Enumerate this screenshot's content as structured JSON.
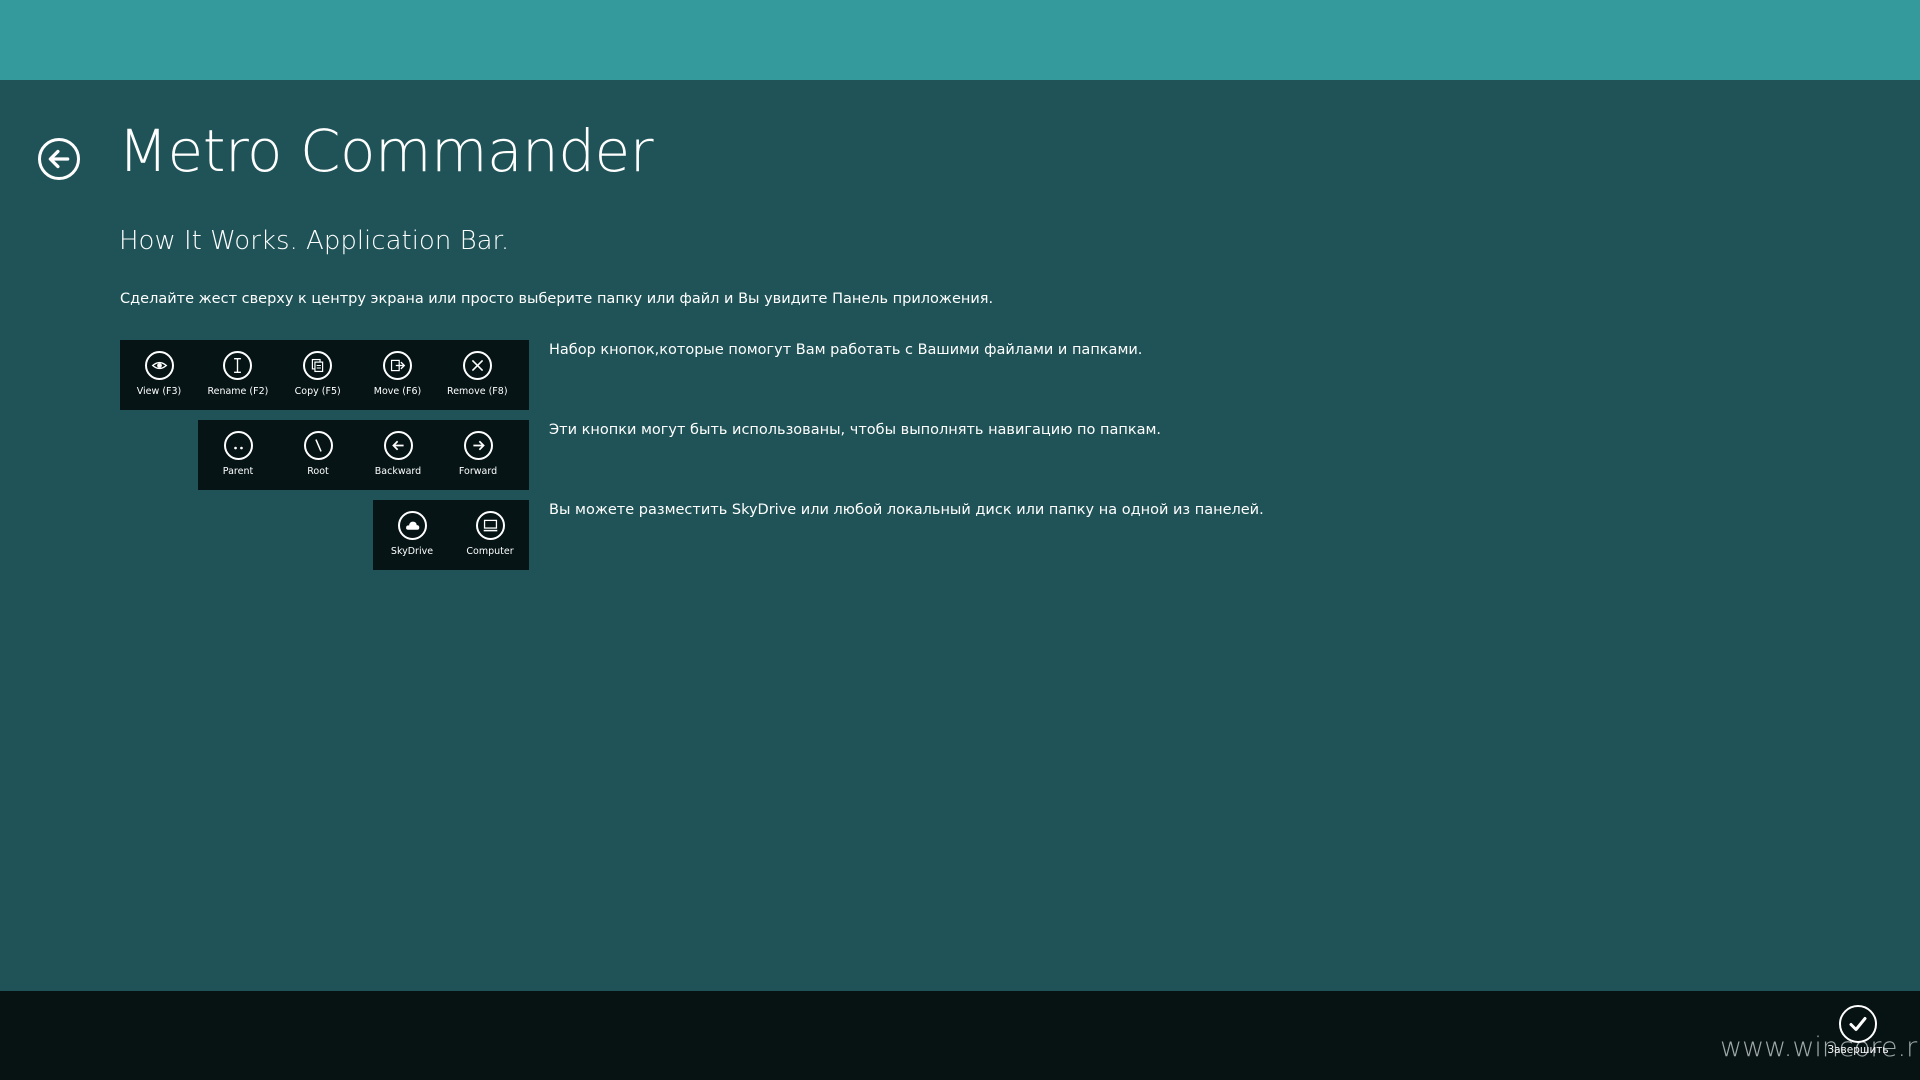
{
  "header": {
    "app_title": "Metro Commander",
    "back_icon": "back-arrow-icon"
  },
  "content": {
    "subtitle": "How It Works. Application Bar.",
    "intro": "Сделайте жест сверху к центру экрана или просто выберите папку или файл и Вы увидите Панель приложения.",
    "file_bar": {
      "description": "Набор кнопок,которые помогут Вам работать с Вашими файлами и папками.",
      "buttons": [
        {
          "label": "View (F3)",
          "icon": "eye-icon"
        },
        {
          "label": "Rename (F2)",
          "icon": "rename-icon"
        },
        {
          "label": "Copy (F5)",
          "icon": "copy-icon"
        },
        {
          "label": "Move (F6)",
          "icon": "move-icon"
        },
        {
          "label": "Remove (F8)",
          "icon": "remove-icon"
        }
      ]
    },
    "nav_bar": {
      "description": "Эти кнопки могут быть использованы, чтобы выполнять навигацию по папкам.",
      "buttons": [
        {
          "label": "Parent",
          "icon": "parent-icon"
        },
        {
          "label": "Root",
          "icon": "root-icon"
        },
        {
          "label": "Backward",
          "icon": "backward-icon"
        },
        {
          "label": "Forward",
          "icon": "forward-icon"
        }
      ]
    },
    "location_bar": {
      "description": "Вы можете разместить SkyDrive или любой локальный диск или папку на одной из панелей.",
      "buttons": [
        {
          "label": "SkyDrive",
          "icon": "cloud-icon"
        },
        {
          "label": "Computer",
          "icon": "computer-icon"
        }
      ]
    }
  },
  "bottom_bar": {
    "finish_label": "Завершить",
    "finish_icon": "checkmark-icon"
  },
  "watermark": "www.wincore.ru",
  "colors": {
    "top_band": "#349a9b",
    "background": "#1f5357",
    "app_bar": "#061416",
    "bottom_bar": "#071213"
  }
}
